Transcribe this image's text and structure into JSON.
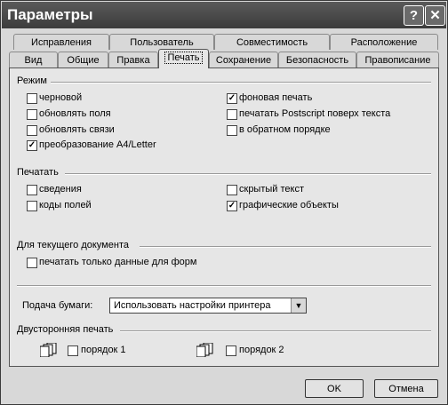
{
  "window": {
    "title": "Параметры",
    "help_icon": "question-icon",
    "close_icon": "close-icon"
  },
  "tabs_row1": [
    "Исправления",
    "Пользователь",
    "Совместимость",
    "Расположение"
  ],
  "tabs_row2": [
    "Вид",
    "Общие",
    "Правка",
    "Печать",
    "Сохранение",
    "Безопасность",
    "Правописание"
  ],
  "active_tab": "Печать",
  "mode": {
    "title": "Режим",
    "left": [
      {
        "label": "черновой",
        "checked": false
      },
      {
        "label": "обновлять поля",
        "checked": false
      },
      {
        "label": "обновлять связи",
        "checked": false
      },
      {
        "label": "преобразование A4/Letter",
        "checked": true
      }
    ],
    "right": [
      {
        "label": "фоновая печать",
        "checked": true
      },
      {
        "label": "печатать Postscript поверх текста",
        "checked": false
      },
      {
        "label": "в обратном порядке",
        "checked": false
      }
    ]
  },
  "print": {
    "title": "Печатать",
    "left": [
      {
        "label": "сведения",
        "checked": false
      },
      {
        "label": "коды полей",
        "checked": false
      }
    ],
    "right": [
      {
        "label": "скрытый текст",
        "checked": false
      },
      {
        "label": "графические объекты",
        "checked": true
      }
    ]
  },
  "document": {
    "title": "Для текущего документа",
    "items": [
      {
        "label": "печатать только данные для форм",
        "checked": false
      }
    ]
  },
  "paper": {
    "label": "Подача бумаги:",
    "value": "Использовать настройки принтера"
  },
  "duplex": {
    "title": "Двусторонняя печать",
    "order1": {
      "label": "порядок 1",
      "checked": false,
      "icon_digits": "135"
    },
    "order2": {
      "label": "порядок 2",
      "checked": false,
      "icon_digits": "246"
    }
  },
  "buttons": {
    "ok": "OK",
    "cancel": "Отмена"
  }
}
